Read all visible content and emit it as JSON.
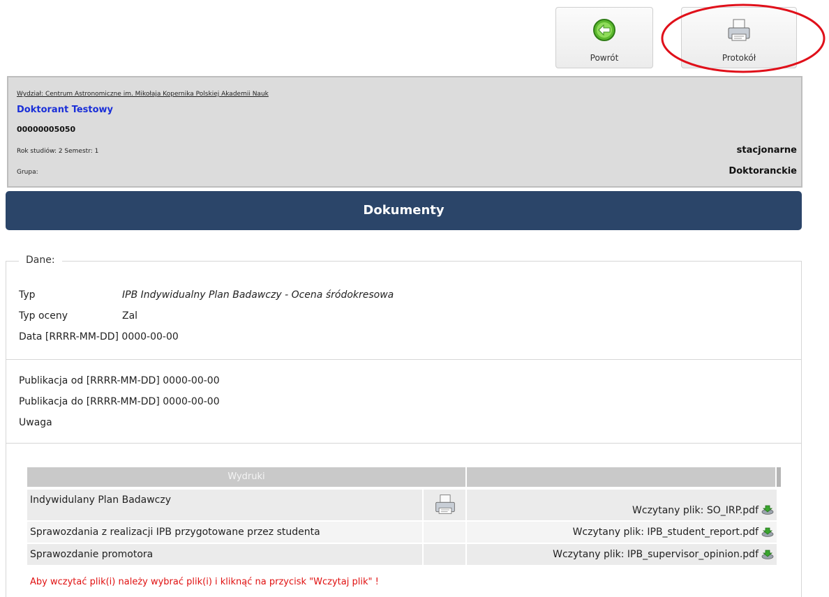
{
  "toolbar": {
    "back_label": "Powrót",
    "protocol_label": "Protokół"
  },
  "student": {
    "faculty": "Wydział: Centrum Astronomiczne im. Mikołaja Kopernika Polskiej Akademii Nauk",
    "name": "Doktorant Testowy",
    "id": "00000005050",
    "year_semester": "Rok studiów: 2 Semestr: 1",
    "group_label": "Grupa:",
    "study_mode": "stacjonarne",
    "study_kind": "Doktoranckie"
  },
  "page_title": "Dokumenty",
  "details": {
    "legend": "Dane:",
    "type_label": "Typ",
    "type_value": "IPB Indywidualny Plan Badawczy - Ocena śródokresowa",
    "grade_type_label": "Typ oceny",
    "grade_type_value": "Zal",
    "date_label": "Data [RRRR-MM-DD]",
    "date_value": "0000-00-00",
    "pub_from_label": "Publikacja od [RRRR-MM-DD]",
    "pub_from_value": "0000-00-00",
    "pub_to_label": "Publikacja do [RRRR-MM-DD]",
    "pub_to_value": "0000-00-00",
    "note_label": "Uwaga"
  },
  "printouts": {
    "header": "Wydruki",
    "rows": [
      {
        "name": "Indywidulany Plan Badawczy",
        "file": "Wczytany plik: SO_IRP.pdf",
        "has_print": true
      },
      {
        "name": "Sprawozdania z realizacji IPB przygotowane przez studenta",
        "file": "Wczytany plik: IPB_student_report.pdf",
        "has_print": false
      },
      {
        "name": "Sprawozdanie promotora",
        "file": "Wczytany plik: IPB_supervisor_opinion.pdf",
        "has_print": false
      }
    ],
    "warning": "Aby wczytać plik(i) należy wybrać plik(i) i kliknąć na przycisk \"Wczytaj plik\" !"
  },
  "colors": {
    "title_bar": "#2b4569",
    "student_name": "#1a2fd8",
    "warning": "#e01010",
    "highlight_ellipse": "#e0101a"
  }
}
